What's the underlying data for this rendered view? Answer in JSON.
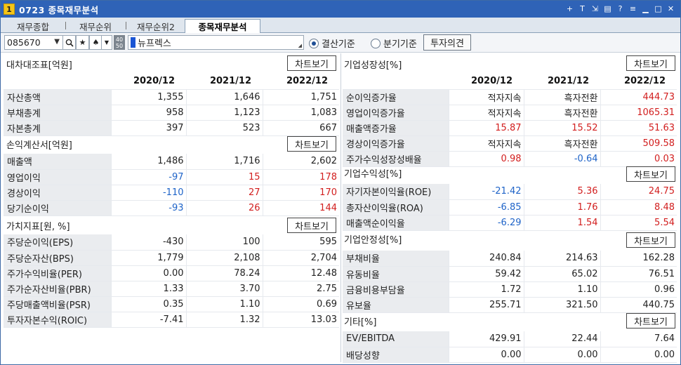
{
  "window": {
    "number": "1",
    "title": "0723 종목재무분석",
    "icons": [
      "plus-icon",
      "text-icon",
      "link-icon",
      "print-icon",
      "help-icon",
      "menu-icon",
      "minimize-icon",
      "maximize-icon",
      "close-icon"
    ]
  },
  "tabs": [
    {
      "label": "재무종합"
    },
    {
      "label": "재무순위"
    },
    {
      "label": "재무순위2"
    },
    {
      "label": "종목재무분석"
    }
  ],
  "toolbar": {
    "code": "085670",
    "badge_top": "40",
    "badge_bottom": "50",
    "stock_name": "뉴프렉스",
    "radio_annual": "결산기준",
    "radio_quarter": "분기기준",
    "opinion_button": "투자의견"
  },
  "chart_button": "차트보기",
  "years": [
    "2020/12",
    "2021/12",
    "2022/12"
  ],
  "left": {
    "balance": {
      "title": "대차대조표[억원]",
      "rows": [
        {
          "label": "자산총액",
          "v": [
            "1,355",
            "1,646",
            "1,751"
          ]
        },
        {
          "label": "부채총계",
          "v": [
            "958",
            "1,123",
            "1,083"
          ]
        },
        {
          "label": "자본총계",
          "v": [
            "397",
            "523",
            "667"
          ]
        }
      ]
    },
    "income": {
      "title": "손익계산서[억원]",
      "rows": [
        {
          "label": "매출액",
          "v": [
            "1,486",
            "1,716",
            "2,602"
          ]
        },
        {
          "label": "영업이익",
          "v": [
            "-97",
            "15",
            "178"
          ]
        },
        {
          "label": "경상이익",
          "v": [
            "-110",
            "27",
            "170"
          ]
        },
        {
          "label": "당기순이익",
          "v": [
            "-93",
            "26",
            "144"
          ]
        }
      ]
    },
    "value": {
      "title": "가치지표[원, %]",
      "rows": [
        {
          "label": "주당순이익(EPS)",
          "v": [
            "-430",
            "100",
            "595"
          ]
        },
        {
          "label": "주당순자산(BPS)",
          "v": [
            "1,779",
            "2,108",
            "2,704"
          ]
        },
        {
          "label": "주가수익비율(PER)",
          "v": [
            "0.00",
            "78.24",
            "12.48"
          ]
        },
        {
          "label": "주가순자산비율(PBR)",
          "v": [
            "1.33",
            "3.70",
            "2.75"
          ]
        },
        {
          "label": "주당매출액비율(PSR)",
          "v": [
            "0.35",
            "1.10",
            "0.69"
          ]
        },
        {
          "label": "투자자본수익(ROIC)",
          "v": [
            "-7.41",
            "1.32",
            "13.03"
          ]
        }
      ]
    }
  },
  "right": {
    "growth": {
      "title": "기업성장성[%]",
      "rows": [
        {
          "label": "순이익증가율",
          "v": [
            "적자지속",
            "흑자전환",
            "444.73"
          ]
        },
        {
          "label": "영업이익증가율",
          "v": [
            "적자지속",
            "흑자전환",
            "1065.31"
          ]
        },
        {
          "label": "매출액증가율",
          "v": [
            "15.87",
            "15.52",
            "51.63"
          ]
        },
        {
          "label": "경상이익증가율",
          "v": [
            "적자지속",
            "흑자전환",
            "509.58"
          ]
        },
        {
          "label": "주가수익성장성배율",
          "v": [
            "0.98",
            "-0.64",
            "0.03"
          ]
        }
      ]
    },
    "profit": {
      "title": "기업수익성[%]",
      "rows": [
        {
          "label": "자기자본이익율(ROE)",
          "v": [
            "-21.42",
            "5.36",
            "24.75"
          ]
        },
        {
          "label": "총자산이익율(ROA)",
          "v": [
            "-6.85",
            "1.76",
            "8.48"
          ]
        },
        {
          "label": "매출액순이익율",
          "v": [
            "-6.29",
            "1.54",
            "5.54"
          ]
        }
      ]
    },
    "stability": {
      "title": "기업안정성[%]",
      "rows": [
        {
          "label": "부채비율",
          "v": [
            "240.84",
            "214.63",
            "162.28"
          ]
        },
        {
          "label": "유동비율",
          "v": [
            "59.42",
            "65.02",
            "76.51"
          ]
        },
        {
          "label": "금융비용부담율",
          "v": [
            "1.72",
            "1.10",
            "0.96"
          ]
        },
        {
          "label": "유보율",
          "v": [
            "255.71",
            "321.50",
            "440.75"
          ]
        }
      ]
    },
    "etc": {
      "title": "기타[%]",
      "rows": [
        {
          "label": "EV/EBITDA",
          "v": [
            "429.91",
            "22.44",
            "7.64"
          ]
        },
        {
          "label": "배당성향",
          "v": [
            "0.00",
            "0.00",
            "0.00"
          ]
        }
      ]
    }
  },
  "colors": {
    "negative": "#1e63c8",
    "positive": "#d21e1e",
    "titlebar": "#2f63b7"
  },
  "color_classes": {
    "left.income.rows.1": [
      "neg",
      "pos",
      "pos"
    ],
    "left.income.rows.2": [
      "neg",
      "pos",
      "pos"
    ],
    "left.income.rows.3": [
      "neg",
      "pos",
      "pos"
    ],
    "right.growth.rows.0": [
      "",
      "",
      "pos"
    ],
    "right.growth.rows.1": [
      "",
      "",
      "pos"
    ],
    "right.growth.rows.2": [
      "pos",
      "pos",
      "pos"
    ],
    "right.growth.rows.3": [
      "",
      "",
      "pos"
    ],
    "right.growth.rows.4": [
      "pos",
      "neg",
      "pos"
    ],
    "right.profit.rows.0": [
      "neg",
      "pos",
      "pos"
    ],
    "right.profit.rows.1": [
      "neg",
      "pos",
      "pos"
    ],
    "right.profit.rows.2": [
      "neg",
      "pos",
      "pos"
    ]
  }
}
